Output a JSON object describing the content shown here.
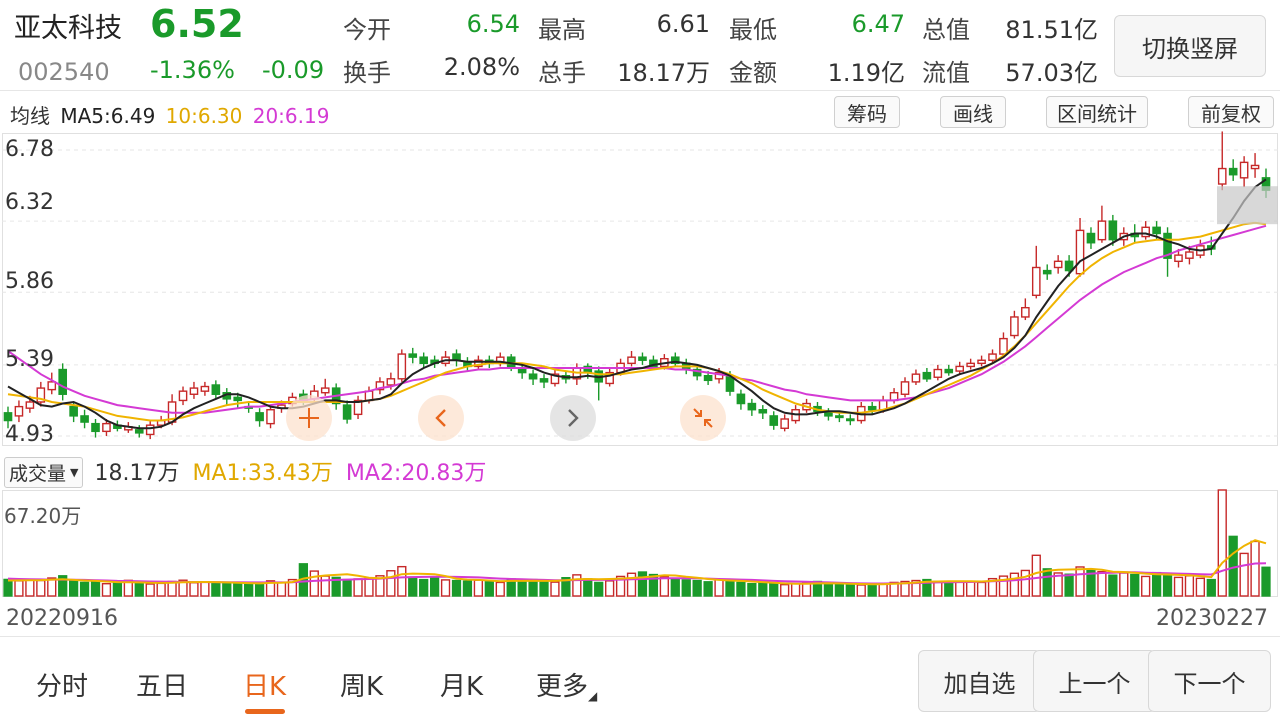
{
  "header": {
    "name": "亚太科技",
    "code": "002540",
    "price": "6.52",
    "change_pct": "-1.36%",
    "change": "-0.09",
    "quotes": [
      {
        "label": "今开",
        "value": "6.54",
        "color": "down"
      },
      {
        "label": "最高",
        "value": "6.61",
        "color": "dark"
      },
      {
        "label": "最低",
        "value": "6.47",
        "color": "down"
      },
      {
        "label": "总值",
        "value": "81.51亿",
        "color": "dark"
      },
      {
        "label": "换手",
        "value": "2.08%",
        "color": "dark"
      },
      {
        "label": "总手",
        "value": "18.17万",
        "color": "dark"
      },
      {
        "label": "金额",
        "value": "1.19亿",
        "color": "dark"
      },
      {
        "label": "流值",
        "value": "57.03亿",
        "color": "dark"
      }
    ],
    "switch_label": "切换竖屏"
  },
  "ma_legend": {
    "title": "均线",
    "ma5": "MA5:6.49",
    "ma10": "10:6.30",
    "ma20": "20:6.19"
  },
  "tools": {
    "chips": "筹码",
    "draw": "画线",
    "range_stats": "区间统计",
    "adjust": "前复权"
  },
  "y_axis": {
    "labels": [
      "6.78",
      "6.32",
      "5.86",
      "5.39",
      "4.93"
    ]
  },
  "volume": {
    "selector": "成交量",
    "value": "18.17万",
    "ma1": "MA1:33.43万",
    "ma2": "MA2:20.83万",
    "max_label": "67.20万"
  },
  "dates": {
    "start": "20220916",
    "end": "20230227"
  },
  "tabs": [
    {
      "label": "分时",
      "active": false
    },
    {
      "label": "五日",
      "active": false
    },
    {
      "label": "日K",
      "active": true
    },
    {
      "label": "周K",
      "active": false
    },
    {
      "label": "月K",
      "active": false
    },
    {
      "label": "更多",
      "active": false
    }
  ],
  "bottom_buttons": {
    "add_watch": "加自选",
    "prev": "上一个",
    "next": "下一个"
  },
  "icons": {
    "crosshair": "crosshair-icon",
    "left": "chevron-left-icon",
    "right": "chevron-right-icon",
    "shrink": "shrink-icon"
  },
  "colors": {
    "up": "#c62828",
    "down": "#1a9a2a",
    "ma5": "#222222",
    "ma10": "#f0b400",
    "ma20": "#d43ad4",
    "accent": "#e8661c"
  },
  "chart_data": {
    "type": "candlestick",
    "y_range": [
      4.93,
      6.78
    ],
    "candles": [
      [
        5.08,
        5.03,
        5.12,
        4.98
      ],
      [
        5.06,
        5.12,
        5.16,
        5.02
      ],
      [
        5.11,
        5.15,
        5.19,
        5.08
      ],
      [
        5.15,
        5.24,
        5.28,
        5.12
      ],
      [
        5.23,
        5.28,
        5.34,
        5.2
      ],
      [
        5.36,
        5.2,
        5.4,
        5.16
      ],
      [
        5.12,
        5.06,
        5.15,
        5.02
      ],
      [
        5.06,
        5.02,
        5.1,
        4.98
      ],
      [
        5.01,
        4.96,
        5.04,
        4.92
      ],
      [
        4.96,
        5.01,
        5.04,
        4.93
      ],
      [
        5.0,
        4.98,
        5.03,
        4.96
      ],
      [
        4.97,
        4.99,
        5.02,
        4.95
      ],
      [
        4.97,
        4.95,
        5.0,
        4.92
      ],
      [
        4.94,
        5.0,
        5.03,
        4.91
      ],
      [
        5.0,
        5.03,
        5.06,
        4.98
      ],
      [
        5.02,
        5.15,
        5.2,
        5.0
      ],
      [
        5.16,
        5.22,
        5.25,
        5.13
      ],
      [
        5.2,
        5.24,
        5.28,
        5.17
      ],
      [
        5.22,
        5.25,
        5.28,
        5.19
      ],
      [
        5.26,
        5.2,
        5.29,
        5.17
      ],
      [
        5.21,
        5.17,
        5.24,
        5.13
      ],
      [
        5.18,
        5.16,
        5.21,
        5.11
      ],
      [
        5.12,
        5.11,
        5.15,
        5.08
      ],
      [
        5.08,
        5.03,
        5.11,
        4.99
      ],
      [
        5.01,
        5.1,
        5.13,
        4.98
      ],
      [
        5.11,
        5.13,
        5.16,
        5.08
      ],
      [
        5.14,
        5.18,
        5.21,
        5.12
      ],
      [
        5.2,
        5.16,
        5.23,
        5.13
      ],
      [
        5.17,
        5.22,
        5.26,
        5.15
      ],
      [
        5.21,
        5.24,
        5.3,
        5.19
      ],
      [
        5.24,
        5.14,
        5.27,
        5.1
      ],
      [
        5.13,
        5.04,
        5.16,
        5.01
      ],
      [
        5.07,
        5.16,
        5.19,
        5.04
      ],
      [
        5.16,
        5.22,
        5.25,
        5.14
      ],
      [
        5.23,
        5.28,
        5.31,
        5.2
      ],
      [
        5.26,
        5.3,
        5.34,
        5.23
      ],
      [
        5.3,
        5.46,
        5.49,
        5.28
      ],
      [
        5.46,
        5.44,
        5.5,
        5.4
      ],
      [
        5.44,
        5.4,
        5.47,
        5.37
      ],
      [
        5.42,
        5.4,
        5.45,
        5.37
      ],
      [
        5.4,
        5.44,
        5.48,
        5.38
      ],
      [
        5.46,
        5.42,
        5.49,
        5.38
      ],
      [
        5.41,
        5.38,
        5.44,
        5.35
      ],
      [
        5.38,
        5.42,
        5.45,
        5.36
      ],
      [
        5.42,
        5.4,
        5.45,
        5.37
      ],
      [
        5.4,
        5.44,
        5.47,
        5.38
      ],
      [
        5.44,
        5.38,
        5.46,
        5.35
      ],
      [
        5.37,
        5.34,
        5.4,
        5.3
      ],
      [
        5.33,
        5.3,
        5.36,
        5.26
      ],
      [
        5.3,
        5.28,
        5.33,
        5.24
      ],
      [
        5.27,
        5.33,
        5.36,
        5.25
      ],
      [
        5.32,
        5.3,
        5.35,
        5.27
      ],
      [
        5.3,
        5.37,
        5.4,
        5.26
      ],
      [
        5.38,
        5.34,
        5.4,
        5.3
      ],
      [
        5.35,
        5.28,
        5.38,
        5.16
      ],
      [
        5.27,
        5.34,
        5.37,
        5.25
      ],
      [
        5.34,
        5.4,
        5.43,
        5.32
      ],
      [
        5.4,
        5.44,
        5.48,
        5.38
      ],
      [
        5.44,
        5.42,
        5.47,
        5.39
      ],
      [
        5.42,
        5.38,
        5.45,
        5.36
      ],
      [
        5.38,
        5.43,
        5.46,
        5.36
      ],
      [
        5.44,
        5.4,
        5.47,
        5.38
      ],
      [
        5.4,
        5.36,
        5.43,
        5.33
      ],
      [
        5.36,
        5.32,
        5.39,
        5.29
      ],
      [
        5.32,
        5.29,
        5.35,
        5.26
      ],
      [
        5.3,
        5.34,
        5.37,
        5.27
      ],
      [
        5.32,
        5.22,
        5.35,
        5.19
      ],
      [
        5.2,
        5.14,
        5.23,
        5.1
      ],
      [
        5.14,
        5.1,
        5.17,
        5.06
      ],
      [
        5.1,
        5.08,
        5.13,
        5.04
      ],
      [
        5.06,
        5.0,
        5.09,
        4.97
      ],
      [
        4.98,
        5.04,
        5.07,
        4.96
      ],
      [
        5.03,
        5.1,
        5.13,
        5.01
      ],
      [
        5.1,
        5.14,
        5.17,
        5.08
      ],
      [
        5.12,
        5.09,
        5.15,
        5.06
      ],
      [
        5.08,
        5.06,
        5.11,
        5.03
      ],
      [
        5.06,
        5.05,
        5.09,
        5.02
      ],
      [
        5.04,
        5.03,
        5.07,
        5.0
      ],
      [
        5.03,
        5.12,
        5.15,
        5.01
      ],
      [
        5.12,
        5.1,
        5.15,
        5.07
      ],
      [
        5.1,
        5.16,
        5.19,
        5.08
      ],
      [
        5.16,
        5.21,
        5.24,
        5.14
      ],
      [
        5.2,
        5.28,
        5.31,
        5.18
      ],
      [
        5.28,
        5.33,
        5.36,
        5.26
      ],
      [
        5.34,
        5.3,
        5.37,
        5.28
      ],
      [
        5.31,
        5.36,
        5.39,
        5.29
      ],
      [
        5.36,
        5.34,
        5.39,
        5.32
      ],
      [
        5.35,
        5.38,
        5.41,
        5.33
      ],
      [
        5.38,
        5.4,
        5.43,
        5.36
      ],
      [
        5.4,
        5.42,
        5.45,
        5.38
      ],
      [
        5.42,
        5.46,
        5.49,
        5.4
      ],
      [
        5.46,
        5.56,
        5.6,
        5.44
      ],
      [
        5.58,
        5.7,
        5.74,
        5.56
      ],
      [
        5.7,
        5.76,
        5.82,
        5.68
      ],
      [
        5.84,
        6.02,
        6.16,
        5.82
      ],
      [
        6.0,
        5.98,
        6.04,
        5.94
      ],
      [
        6.02,
        6.06,
        6.1,
        5.98
      ],
      [
        6.06,
        6.0,
        6.1,
        5.96
      ],
      [
        5.98,
        6.26,
        6.34,
        5.96
      ],
      [
        6.24,
        6.18,
        6.28,
        6.14
      ],
      [
        6.2,
        6.32,
        6.42,
        6.18
      ],
      [
        6.32,
        6.2,
        6.36,
        6.16
      ],
      [
        6.2,
        6.24,
        6.28,
        6.16
      ],
      [
        6.24,
        6.22,
        6.3,
        6.18
      ],
      [
        6.22,
        6.28,
        6.32,
        6.2
      ],
      [
        6.28,
        6.24,
        6.32,
        6.2
      ],
      [
        6.24,
        6.08,
        6.28,
        5.96
      ],
      [
        6.06,
        6.1,
        6.14,
        6.02
      ],
      [
        6.08,
        6.12,
        6.16,
        6.04
      ],
      [
        6.1,
        6.16,
        6.2,
        6.08
      ],
      [
        6.16,
        6.14,
        6.22,
        6.1
      ],
      [
        6.56,
        6.66,
        6.9,
        6.52
      ],
      [
        6.66,
        6.62,
        6.72,
        6.58
      ],
      [
        6.6,
        6.7,
        6.74,
        6.54
      ],
      [
        6.66,
        6.68,
        6.76,
        6.6
      ],
      [
        6.6,
        6.52,
        6.66,
        6.47
      ]
    ],
    "ma5": [
      5.25,
      5.21,
      5.17,
      5.13,
      5.12,
      5.14,
      5.15,
      5.12,
      5.08,
      5.03,
      5.0,
      4.99,
      4.98,
      4.98,
      4.99,
      5.02,
      5.07,
      5.11,
      5.14,
      5.17,
      5.2,
      5.2,
      5.18,
      5.15,
      5.12,
      5.11,
      5.11,
      5.12,
      5.14,
      5.16,
      5.16,
      5.15,
      5.15,
      5.16,
      5.17,
      5.2,
      5.27,
      5.33,
      5.37,
      5.4,
      5.42,
      5.42,
      5.41,
      5.41,
      5.41,
      5.41,
      5.4,
      5.39,
      5.37,
      5.34,
      5.32,
      5.31,
      5.31,
      5.32,
      5.31,
      5.32,
      5.34,
      5.36,
      5.37,
      5.39,
      5.4,
      5.41,
      5.4,
      5.39,
      5.37,
      5.35,
      5.32,
      5.27,
      5.22,
      5.16,
      5.11,
      5.08,
      5.07,
      5.07,
      5.08,
      5.09,
      5.09,
      5.08,
      5.07,
      5.07,
      5.09,
      5.11,
      5.14,
      5.18,
      5.22,
      5.26,
      5.3,
      5.33,
      5.35,
      5.37,
      5.4,
      5.44,
      5.5,
      5.58,
      5.7,
      5.8,
      5.9,
      5.98,
      6.06,
      6.1,
      6.14,
      6.18,
      6.22,
      6.24,
      6.24,
      6.22,
      6.19,
      6.17,
      6.14,
      6.13,
      6.14,
      6.24,
      6.34,
      6.45,
      6.54,
      6.59
    ],
    "ma10": [
      5.2,
      5.19,
      5.18,
      5.17,
      5.15,
      5.14,
      5.13,
      5.12,
      5.1,
      5.08,
      5.06,
      5.05,
      5.04,
      5.03,
      5.03,
      5.04,
      5.05,
      5.07,
      5.09,
      5.11,
      5.13,
      5.14,
      5.15,
      5.15,
      5.15,
      5.15,
      5.15,
      5.15,
      5.15,
      5.15,
      5.15,
      5.15,
      5.15,
      5.16,
      5.17,
      5.19,
      5.22,
      5.25,
      5.28,
      5.31,
      5.34,
      5.36,
      5.38,
      5.39,
      5.4,
      5.4,
      5.4,
      5.4,
      5.39,
      5.38,
      5.36,
      5.35,
      5.34,
      5.34,
      5.33,
      5.33,
      5.33,
      5.34,
      5.35,
      5.36,
      5.37,
      5.38,
      5.38,
      5.38,
      5.37,
      5.35,
      5.33,
      5.3,
      5.27,
      5.23,
      5.2,
      5.17,
      5.14,
      5.12,
      5.1,
      5.09,
      5.08,
      5.08,
      5.08,
      5.09,
      5.1,
      5.12,
      5.14,
      5.17,
      5.2,
      5.23,
      5.26,
      5.29,
      5.32,
      5.36,
      5.4,
      5.45,
      5.51,
      5.58,
      5.66,
      5.74,
      5.82,
      5.9,
      5.97,
      6.03,
      6.08,
      6.12,
      6.15,
      6.18,
      6.19,
      6.2,
      6.2,
      6.2,
      6.21,
      6.22,
      6.24,
      6.26,
      6.28,
      6.3,
      6.31,
      6.3
    ],
    "ma20": [
      5.48,
      5.43,
      5.38,
      5.33,
      5.29,
      5.25,
      5.22,
      5.19,
      5.17,
      5.15,
      5.13,
      5.12,
      5.11,
      5.1,
      5.09,
      5.08,
      5.08,
      5.08,
      5.08,
      5.09,
      5.1,
      5.11,
      5.12,
      5.12,
      5.13,
      5.14,
      5.15,
      5.16,
      5.17,
      5.18,
      5.19,
      5.2,
      5.21,
      5.22,
      5.24,
      5.25,
      5.27,
      5.29,
      5.3,
      5.32,
      5.33,
      5.34,
      5.35,
      5.36,
      5.36,
      5.37,
      5.37,
      5.37,
      5.37,
      5.37,
      5.37,
      5.37,
      5.37,
      5.37,
      5.37,
      5.37,
      5.37,
      5.37,
      5.37,
      5.37,
      5.37,
      5.36,
      5.36,
      5.35,
      5.34,
      5.33,
      5.32,
      5.3,
      5.29,
      5.27,
      5.25,
      5.23,
      5.22,
      5.2,
      5.19,
      5.18,
      5.17,
      5.16,
      5.16,
      5.16,
      5.16,
      5.16,
      5.17,
      5.18,
      5.2,
      5.22,
      5.24,
      5.27,
      5.3,
      5.33,
      5.37,
      5.41,
      5.46,
      5.51,
      5.57,
      5.63,
      5.69,
      5.75,
      5.81,
      5.86,
      5.91,
      5.95,
      5.99,
      6.02,
      6.05,
      6.08,
      6.1,
      6.13,
      6.15,
      6.17,
      6.19,
      6.21,
      6.23,
      6.25,
      6.27,
      6.29
    ],
    "volume": [
      10.5,
      9.6,
      10.2,
      9.8,
      11.4,
      12.8,
      9.4,
      8.6,
      9.0,
      7.8,
      8.4,
      9.9,
      8.1,
      7.6,
      8.0,
      9.2,
      10.0,
      8.4,
      8.8,
      8.2,
      8.6,
      7.8,
      7.4,
      8.0,
      9.6,
      8.4,
      10.4,
      20.4,
      15.8,
      12.6,
      11.8,
      10.4,
      10.8,
      11.2,
      12.8,
      16.0,
      18.6,
      12.0,
      10.4,
      11.6,
      10.2,
      9.8,
      9.4,
      10.0,
      9.0,
      8.6,
      10.8,
      9.8,
      10.4,
      9.2,
      8.8,
      11.6,
      13.4,
      10.8,
      8.6,
      9.6,
      12.4,
      14.4,
      15.2,
      13.6,
      12.2,
      10.6,
      10.2,
      9.8,
      9.0,
      10.4,
      9.8,
      8.6,
      7.8,
      8.2,
      7.6,
      7.2,
      7.8,
      8.6,
      9.2,
      8.2,
      7.6,
      7.2,
      7.0,
      7.4,
      8.0,
      8.6,
      9.2,
      9.8,
      10.4,
      9.2,
      8.8,
      9.4,
      9.0,
      8.6,
      11.0,
      12.6,
      14.4,
      16.2,
      25.8,
      17.2,
      14.6,
      13.8,
      18.4,
      16.2,
      15.4,
      13.2,
      14.6,
      13.6,
      12.4,
      14.8,
      13.2,
      11.8,
      12.8,
      11.2,
      10.4,
      67.2,
      37.8,
      27.0,
      34.6,
      18.2
    ],
    "volume_ma1": [
      9.8,
      9.9,
      10.0,
      10.1,
      10.4,
      10.6,
      10.2,
      9.8,
      9.6,
      9.2,
      8.8,
      8.7,
      8.6,
      8.4,
      8.3,
      8.4,
      8.7,
      8.8,
      8.9,
      8.8,
      8.6,
      8.4,
      8.2,
      8.0,
      8.3,
      8.4,
      8.8,
      11.0,
      12.2,
      13.0,
      13.4,
      13.8,
      12.8,
      11.6,
      11.2,
      12.0,
      13.8,
      14.2,
      14.0,
      13.8,
      12.6,
      11.0,
      10.4,
      10.2,
      9.8,
      9.4,
      9.6,
      9.6,
      9.7,
      9.6,
      9.6,
      10.0,
      10.6,
      10.8,
      10.6,
      10.8,
      11.0,
      11.4,
      11.8,
      12.4,
      13.2,
      13.0,
      12.2,
      11.6,
      10.8,
      10.2,
      9.8,
      9.6,
      9.2,
      8.8,
      8.4,
      8.0,
      7.8,
      7.8,
      8.0,
      8.1,
      8.0,
      7.8,
      7.6,
      7.4,
      7.5,
      7.8,
      8.1,
      8.5,
      9.0,
      9.2,
      9.3,
      9.4,
      9.4,
      9.2,
      9.6,
      10.2,
      11.0,
      12.2,
      14.6,
      16.0,
      16.6,
      16.8,
      17.0,
      17.2,
      16.6,
      15.4,
      15.2,
      14.8,
      14.2,
      13.8,
      13.6,
      13.4,
      13.2,
      12.6,
      12.0,
      21.0,
      27.0,
      31.8,
      35.4,
      33.4
    ],
    "volume_ma2": [
      11.0,
      10.8,
      10.6,
      10.5,
      10.4,
      10.4,
      10.3,
      10.2,
      10.0,
      9.8,
      9.6,
      9.5,
      9.4,
      9.2,
      9.1,
      9.0,
      8.9,
      8.8,
      8.8,
      8.8,
      8.7,
      8.7,
      8.6,
      8.6,
      8.6,
      8.6,
      8.7,
      9.2,
      9.6,
      9.9,
      10.2,
      10.4,
      10.6,
      10.8,
      11.0,
      11.4,
      11.8,
      12.0,
      12.1,
      12.2,
      12.2,
      12.1,
      12.0,
      11.8,
      11.4,
      11.0,
      10.8,
      10.6,
      10.4,
      10.2,
      10.0,
      10.0,
      10.1,
      10.2,
      10.2,
      10.3,
      10.4,
      10.6,
      10.8,
      11.0,
      11.2,
      11.3,
      11.3,
      11.2,
      11.0,
      10.8,
      10.6,
      10.4,
      10.2,
      9.9,
      9.6,
      9.4,
      9.2,
      9.0,
      8.8,
      8.6,
      8.4,
      8.2,
      8.0,
      7.9,
      7.9,
      8.0,
      8.1,
      8.2,
      8.4,
      8.6,
      8.7,
      8.8,
      8.9,
      9.0,
      9.3,
      9.6,
      10.0,
      10.6,
      11.4,
      12.2,
      12.8,
      13.2,
      13.8,
      14.2,
      14.6,
      14.8,
      15.0,
      15.0,
      14.8,
      14.6,
      14.4,
      14.2,
      14.0,
      13.8,
      13.6,
      16.0,
      18.0,
      19.4,
      20.6,
      20.8
    ]
  }
}
